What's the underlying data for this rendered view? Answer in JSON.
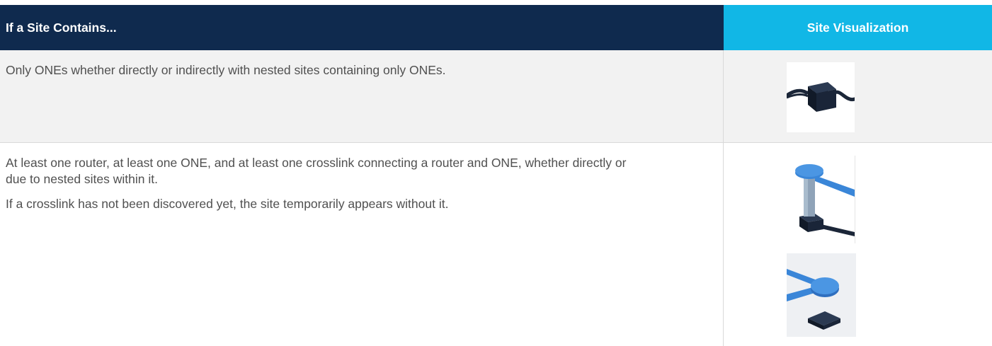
{
  "header": {
    "col1": "If a Site Contains...",
    "col2": "Site Visualization"
  },
  "rows": [
    {
      "text": [
        "Only ONEs whether directly or indirectly with nested sites containing only ONEs."
      ],
      "visuals": [
        "one-site-icon"
      ]
    },
    {
      "text": [
        "At least one router, at least one ONE, and at least one crosslink connecting a router and ONE, whether directly or due to nested sites within it.",
        "If a crosslink has not been discovered yet, the site temporarily appears without it."
      ],
      "visuals": [
        "router-one-crosslink-icon",
        "router-one-no-crosslink-icon"
      ]
    }
  ],
  "colors": {
    "header_dark": "#0f2a4e",
    "header_accent": "#11b7e6",
    "row_alt": "#f2f2f2",
    "text": "#505050",
    "link_blue": "#3a86d8",
    "node_dark": "#172234"
  }
}
